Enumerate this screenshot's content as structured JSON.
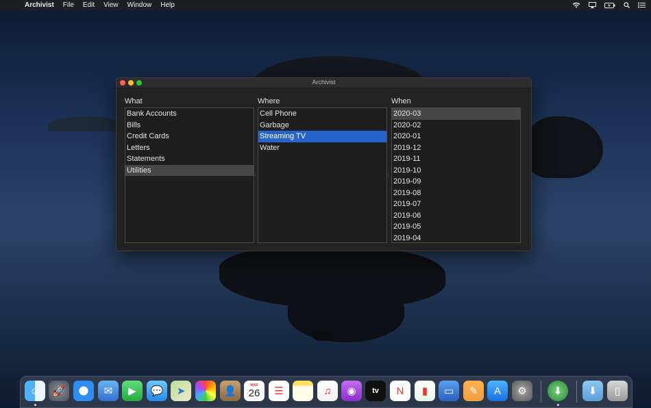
{
  "menubar": {
    "app_name": "Archivist",
    "items": [
      "File",
      "Edit",
      "View",
      "Window",
      "Help"
    ]
  },
  "window": {
    "title": "Archivist",
    "columns": {
      "what": {
        "header": "What",
        "items": [
          "Bank Accounts",
          "Bills",
          "Credit Cards",
          "Letters",
          "Statements",
          "Utilities"
        ],
        "selected": "Utilities"
      },
      "where": {
        "header": "Where",
        "items": [
          "Cell Phone",
          "Garbage",
          "Streaming TV",
          "Water"
        ],
        "selected": "Streaming TV"
      },
      "when": {
        "header": "When",
        "items": [
          "2020-03",
          "2020-02",
          "2020-01",
          "2019-12",
          "2019-11",
          "2019-10",
          "2019-09",
          "2019-08",
          "2019-07",
          "2019-06",
          "2019-05",
          "2019-04"
        ],
        "selected": "2020-03"
      }
    }
  },
  "dock": {
    "calendar_day": "26",
    "calendar_month": "MAR",
    "icons": [
      "finder-icon",
      "launchpad-icon",
      "safari-icon",
      "mail-icon",
      "facetime-icon",
      "messages-icon",
      "maps-icon",
      "photos-icon",
      "contacts-icon",
      "calendar-icon",
      "reminders-icon",
      "notes-icon",
      "music-icon",
      "podcasts-icon",
      "tv-icon",
      "news-icon",
      "numbers-icon",
      "keynote-icon",
      "pages-icon",
      "app-store-icon",
      "system-preferences-icon",
      "archivist-icon",
      "downloads-folder-icon",
      "trash-icon"
    ]
  }
}
